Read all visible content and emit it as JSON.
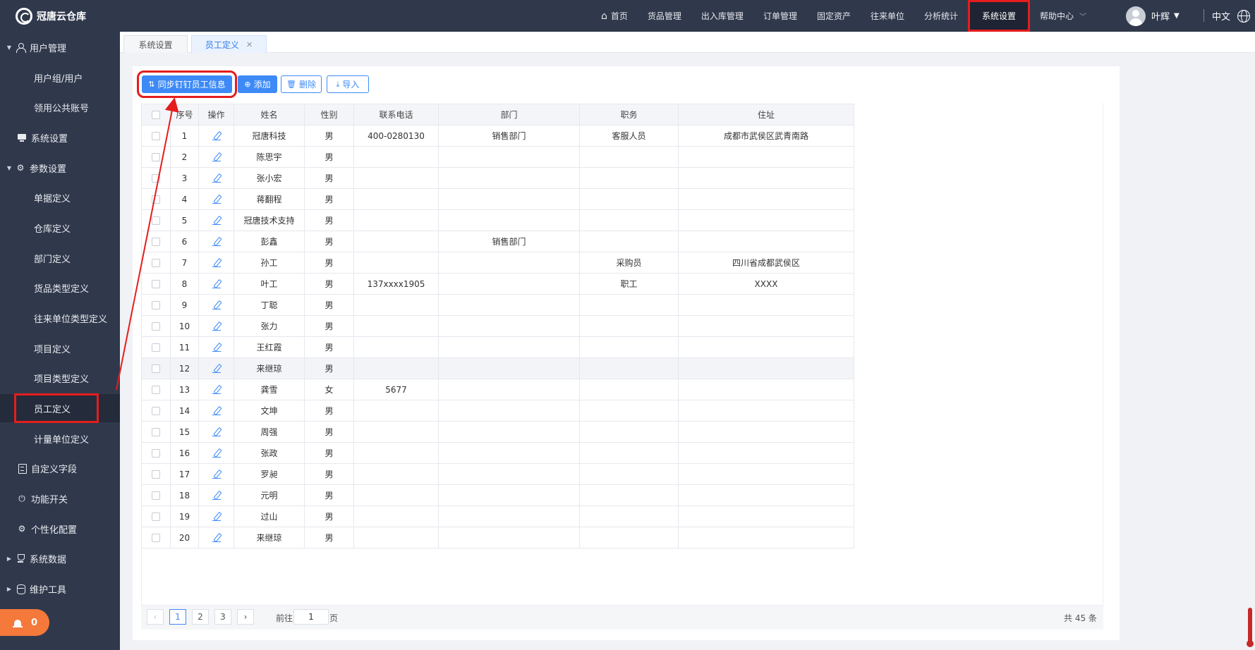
{
  "app": {
    "name": "冠唐云仓库"
  },
  "topnav": {
    "items": [
      {
        "label": "首页",
        "icon": "home-icon"
      },
      {
        "label": "货品管理"
      },
      {
        "label": "出入库管理"
      },
      {
        "label": "订单管理"
      },
      {
        "label": "固定资产"
      },
      {
        "label": "往来单位"
      },
      {
        "label": "分析统计"
      },
      {
        "label": "系统设置",
        "active": true
      },
      {
        "label": "帮助中心",
        "dropdown": true
      }
    ],
    "user": "叶辉",
    "language": "中文"
  },
  "sidebar": {
    "items": [
      {
        "label": "用户管理",
        "kind": "group",
        "expanded": true,
        "icon": "user-icon"
      },
      {
        "label": "用户组/用户",
        "kind": "sub"
      },
      {
        "label": "领用公共账号",
        "kind": "sub"
      },
      {
        "label": "系统设置",
        "kind": "top",
        "icon": "monitor-icon"
      },
      {
        "label": "参数设置",
        "kind": "group",
        "expanded": true,
        "icon": "gear-icon"
      },
      {
        "label": "单据定义",
        "kind": "sub"
      },
      {
        "label": "仓库定义",
        "kind": "sub"
      },
      {
        "label": "部门定义",
        "kind": "sub"
      },
      {
        "label": "货品类型定义",
        "kind": "sub"
      },
      {
        "label": "往来单位类型定义",
        "kind": "sub"
      },
      {
        "label": "项目定义",
        "kind": "sub"
      },
      {
        "label": "项目类型定义",
        "kind": "sub"
      },
      {
        "label": "员工定义",
        "kind": "sub",
        "active": true
      },
      {
        "label": "计量单位定义",
        "kind": "sub"
      },
      {
        "label": "自定义字段",
        "kind": "top",
        "icon": "form-icon"
      },
      {
        "label": "功能开关",
        "kind": "top",
        "icon": "power-icon"
      },
      {
        "label": "个性化配置",
        "kind": "top",
        "icon": "gear-icon"
      },
      {
        "label": "系统数据",
        "kind": "group",
        "expanded": false,
        "icon": "trophy-icon"
      },
      {
        "label": "维护工具",
        "kind": "group",
        "expanded": false,
        "icon": "database-icon"
      }
    ],
    "alarm_count": "0"
  },
  "tabs": [
    {
      "label": "系统设置",
      "active": false
    },
    {
      "label": "员工定义",
      "active": true,
      "closable": true
    }
  ],
  "toolbar": {
    "sync_label": "同步钉钉员工信息",
    "add_label": "添加",
    "delete_label": "删除",
    "import_label": "导入"
  },
  "table": {
    "columns": [
      "序号",
      "操作",
      "姓名",
      "性别",
      "联系电话",
      "部门",
      "职务",
      "住址"
    ],
    "rows": [
      [
        "1",
        "冠唐科技",
        "男",
        "400-0280130",
        "销售部门",
        "客服人员",
        "成都市武侯区武青南路"
      ],
      [
        "2",
        "陈思宇",
        "男",
        "",
        "",
        "",
        ""
      ],
      [
        "3",
        "张小宏",
        "男",
        "",
        "",
        "",
        ""
      ],
      [
        "4",
        "蒋翻程",
        "男",
        "",
        "",
        "",
        ""
      ],
      [
        "5",
        "冠唐技术支持",
        "男",
        "",
        "",
        "",
        ""
      ],
      [
        "6",
        "彭鑫",
        "男",
        "",
        "销售部门",
        "",
        ""
      ],
      [
        "7",
        "孙工",
        "男",
        "",
        "",
        "采购员",
        "四川省成都武侯区"
      ],
      [
        "8",
        "叶工",
        "男",
        "137xxxx1905",
        "",
        "职工",
        "XXXX"
      ],
      [
        "9",
        "丁聪",
        "男",
        "",
        "",
        "",
        ""
      ],
      [
        "10",
        "张力",
        "男",
        "",
        "",
        "",
        ""
      ],
      [
        "11",
        "王红霞",
        "男",
        "",
        "",
        "",
        ""
      ],
      [
        "12",
        "来继琼",
        "男",
        "",
        "",
        "",
        ""
      ],
      [
        "13",
        "龚雪",
        "女",
        "5677",
        "",
        "",
        ""
      ],
      [
        "14",
        "文坤",
        "男",
        "",
        "",
        "",
        ""
      ],
      [
        "15",
        "周强",
        "男",
        "",
        "",
        "",
        ""
      ],
      [
        "16",
        "张政",
        "男",
        "",
        "",
        "",
        ""
      ],
      [
        "17",
        "罗昶",
        "男",
        "",
        "",
        "",
        ""
      ],
      [
        "18",
        "元明",
        "男",
        "",
        "",
        "",
        ""
      ],
      [
        "19",
        "过山",
        "男",
        "",
        "",
        "",
        ""
      ],
      [
        "20",
        "来继琼",
        "男",
        "",
        "",
        "",
        ""
      ]
    ]
  },
  "pagination": {
    "pages": [
      "1",
      "2",
      "3"
    ],
    "current": "1",
    "goto_prefix": "前往",
    "goto_value": "1",
    "goto_suffix": "页",
    "total": "共 45 条"
  },
  "colors": {
    "nav_bg": "#30394c",
    "accent": "#3d8af7",
    "annotation_red": "#e51d1d",
    "alarm_orange": "#f5793b"
  }
}
